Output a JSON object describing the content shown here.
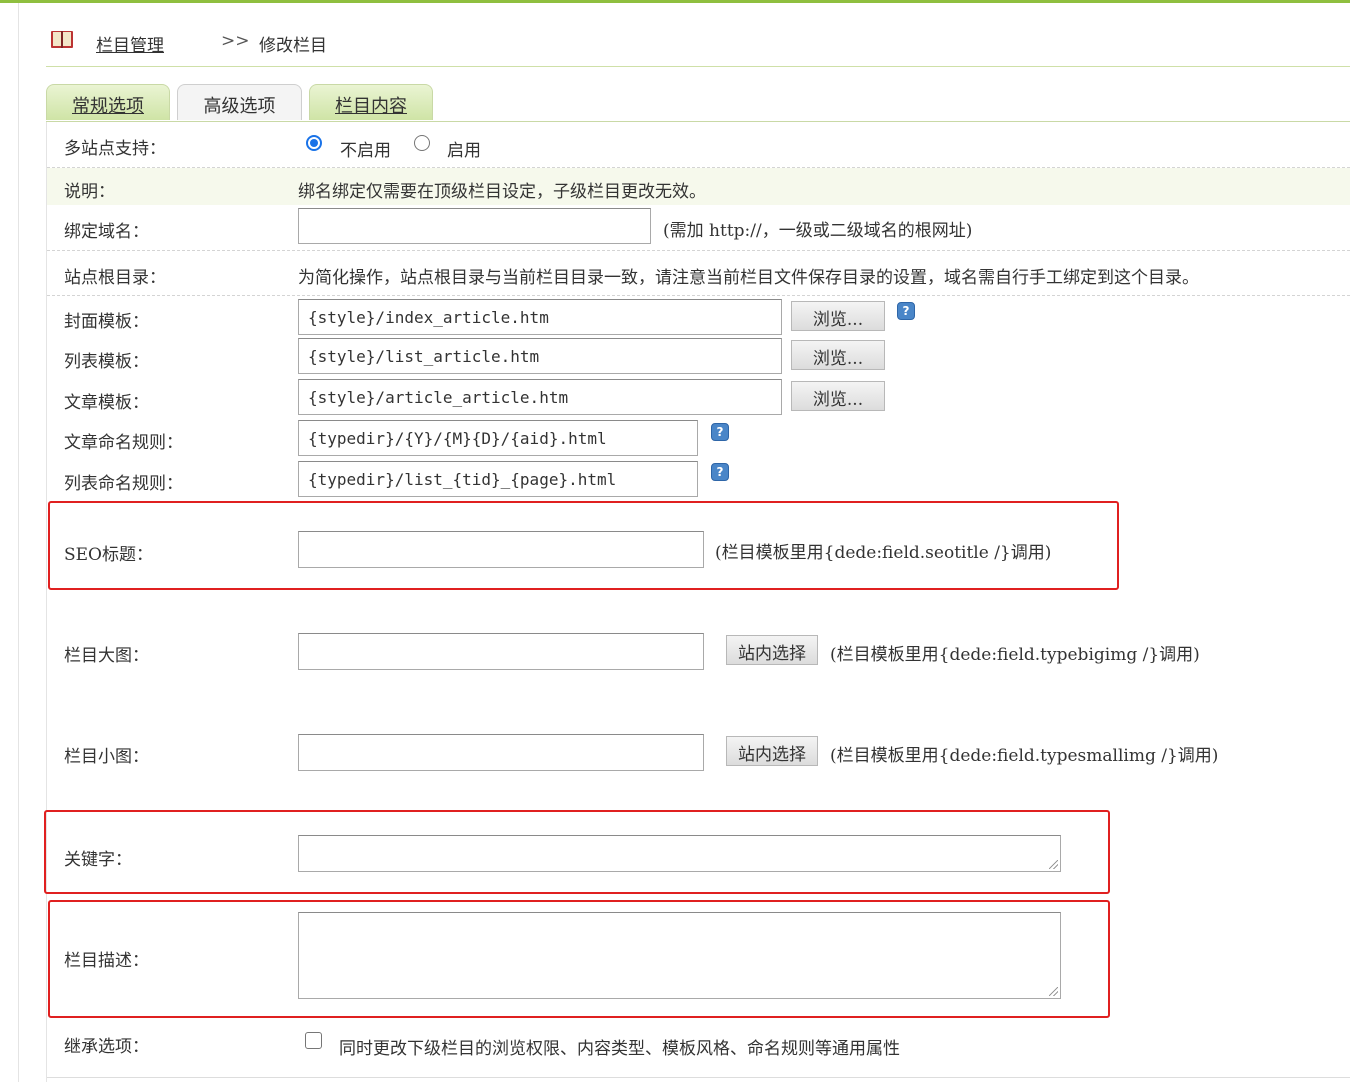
{
  "breadcrumb": {
    "icon": "book-icon",
    "parent_link": "栏目管理",
    "separator": ">>",
    "current": "修改栏目"
  },
  "tabs": [
    {
      "label": "常规选项",
      "active": false
    },
    {
      "label": "高级选项",
      "active": true
    },
    {
      "label": "栏目内容",
      "active": false
    }
  ],
  "form": {
    "multisite": {
      "label": "多站点支持：",
      "options": [
        "不启用",
        "启用"
      ],
      "selected": "不启用"
    },
    "note": {
      "label": "说明：",
      "text": "绑名绑定仅需要在顶级栏目设定，子级栏目更改无效。"
    },
    "domain": {
      "label": "绑定域名：",
      "value": "",
      "hint": "(需加 http://，一级或二级域名的根网址)"
    },
    "root_dir": {
      "label": "站点根目录：",
      "text": "为简化操作，站点根目录与当前栏目目录一致，请注意当前栏目文件保存目录的设置，域名需自行手工绑定到这个目录。"
    },
    "index_template": {
      "label": "封面模板：",
      "value": "{style}/index_article.htm",
      "button": "浏览..."
    },
    "list_template": {
      "label": "列表模板：",
      "value": "{style}/list_article.htm",
      "button": "浏览..."
    },
    "article_template": {
      "label": "文章模板：",
      "value": "{style}/article_article.htm",
      "button": "浏览..."
    },
    "article_naming": {
      "label": "文章命名规则：",
      "value": "{typedir}/{Y}/{M}{D}/{aid}.html"
    },
    "list_naming": {
      "label": "列表命名规则：",
      "value": "{typedir}/list_{tid}_{page}.html"
    },
    "seo_title": {
      "label": "SEO标题：",
      "value": "",
      "hint": "(栏目模板里用{dede:field.seotitle /}调用)"
    },
    "big_image": {
      "label": "栏目大图：",
      "value": "",
      "button": "站内选择",
      "hint": "(栏目模板里用{dede:field.typebigimg /}调用)"
    },
    "small_image": {
      "label": "栏目小图：",
      "value": "",
      "button": "站内选择",
      "hint": "(栏目模板里用{dede:field.typesmallimg /}调用)"
    },
    "keywords": {
      "label": "关键字：",
      "value": ""
    },
    "description": {
      "label": "栏目描述：",
      "value": ""
    },
    "inherit": {
      "label": "继承选项：",
      "checked": false,
      "text": "同时更改下级栏目的浏览权限、内容类型、模板风格、命名规则等通用属性"
    }
  },
  "colors": {
    "accent_green": "#8fbf3f",
    "highlight_red": "#e02020",
    "radio_blue": "#1a73e8"
  }
}
